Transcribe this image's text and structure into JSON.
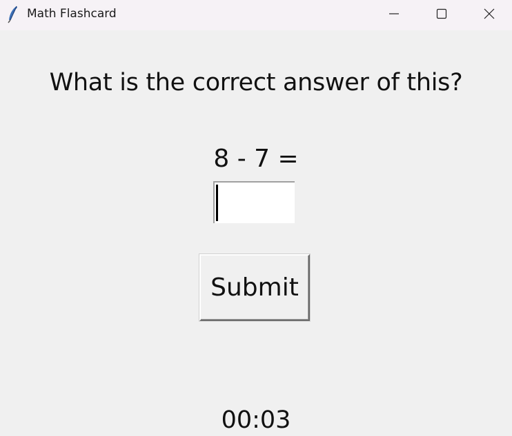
{
  "window": {
    "title": "Math Flashcard",
    "icon": "feather-icon",
    "controls": [
      "minimize-icon",
      "maximize-icon",
      "close-icon"
    ]
  },
  "main": {
    "question": "What is the correct answer of this?",
    "problem": "8 - 7 =",
    "answer": {
      "value": "",
      "placeholder": ""
    },
    "submit_label": "Submit",
    "timer": "00:03"
  }
}
